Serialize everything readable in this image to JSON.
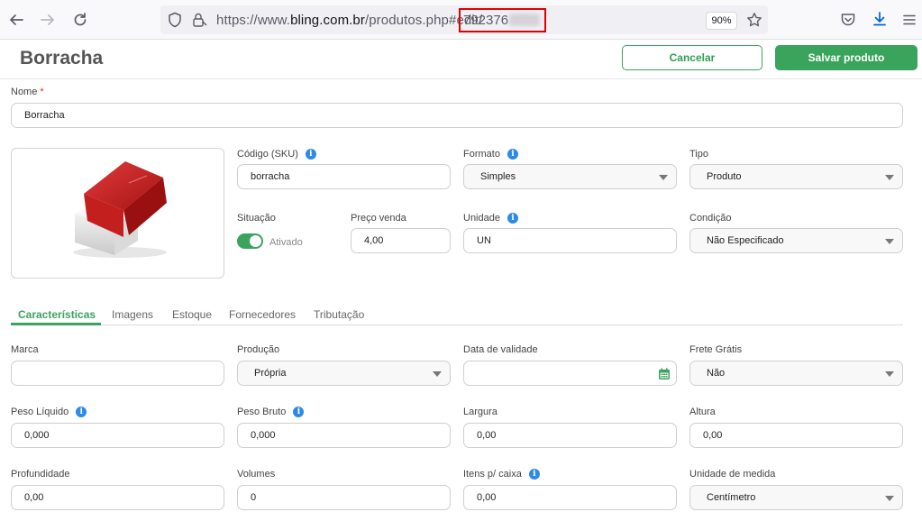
{
  "browser": {
    "url_prefix": "https://www.",
    "url_domain": "bling.com.br",
    "url_path": "/produtos.php#edit/",
    "url_id_visible": "792376",
    "zoom": "90%"
  },
  "header": {
    "title": "Borracha",
    "cancel_label": "Cancelar",
    "save_label": "Salvar produto"
  },
  "form": {
    "nome": {
      "label": "Nome",
      "required": "*",
      "value": "Borracha"
    },
    "codigo": {
      "label": "Código (SKU)",
      "value": "borracha"
    },
    "formato": {
      "label": "Formato",
      "value": "Simples"
    },
    "tipo": {
      "label": "Tipo",
      "value": "Produto"
    },
    "situacao": {
      "label": "Situação",
      "value": "Ativado",
      "on": true
    },
    "preco": {
      "label": "Preço venda",
      "value": "4,00"
    },
    "unidade": {
      "label": "Unidade",
      "value": "UN"
    },
    "condicao": {
      "label": "Condição",
      "value": "Não Especificado"
    }
  },
  "tabs": [
    {
      "label": "Características",
      "active": true
    },
    {
      "label": "Imagens"
    },
    {
      "label": "Estoque"
    },
    {
      "label": "Fornecedores"
    },
    {
      "label": "Tributação"
    }
  ],
  "details": {
    "marca": {
      "label": "Marca",
      "value": ""
    },
    "producao": {
      "label": "Produção",
      "value": "Própria"
    },
    "validade": {
      "label": "Data de validade",
      "value": ""
    },
    "frete": {
      "label": "Frete Grátis",
      "value": "Não"
    },
    "peso_liquido": {
      "label": "Peso Líquido",
      "value": "0,000"
    },
    "peso_bruto": {
      "label": "Peso Bruto",
      "value": "0,000"
    },
    "largura": {
      "label": "Largura",
      "value": "0,00"
    },
    "altura": {
      "label": "Altura",
      "value": "0,00"
    },
    "profundidade": {
      "label": "Profundidade",
      "value": "0,00"
    },
    "volumes": {
      "label": "Volumes",
      "value": "0"
    },
    "itens_caixa": {
      "label": "Itens p/ caixa",
      "value": "0,00"
    },
    "unidade_medida": {
      "label": "Unidade de medida",
      "value": "Centímetro"
    }
  },
  "colors": {
    "accent": "#3aa35c",
    "info": "#2d8ae5",
    "highlight": "#e00000"
  }
}
